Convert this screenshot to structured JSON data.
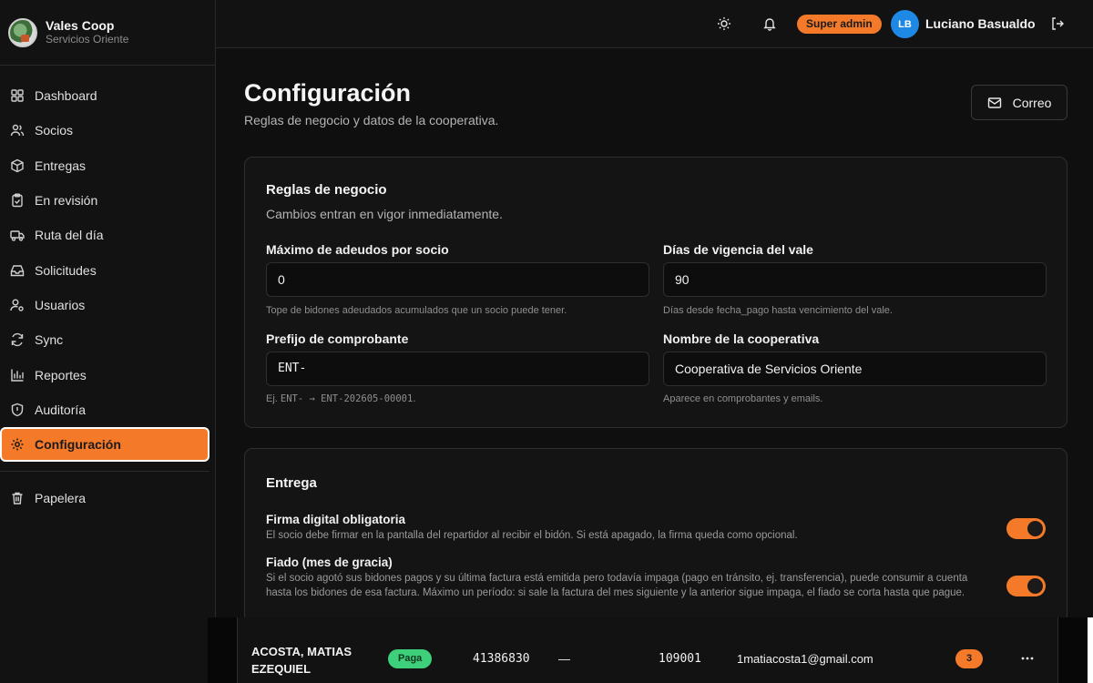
{
  "brand": {
    "name": "Vales Coop",
    "subtitle": "Servicios Oriente"
  },
  "sidebar": {
    "items": [
      {
        "label": "Dashboard",
        "icon": "grid-icon"
      },
      {
        "label": "Socios",
        "icon": "users-icon"
      },
      {
        "label": "Entregas",
        "icon": "package-icon"
      },
      {
        "label": "En revisión",
        "icon": "clipboard-icon"
      },
      {
        "label": "Ruta del día",
        "icon": "truck-icon"
      },
      {
        "label": "Solicitudes",
        "icon": "inbox-icon"
      },
      {
        "label": "Usuarios",
        "icon": "user-cog-icon"
      },
      {
        "label": "Sync",
        "icon": "refresh-icon"
      },
      {
        "label": "Reportes",
        "icon": "bar-chart-icon"
      },
      {
        "label": "Auditoría",
        "icon": "shield-icon"
      },
      {
        "label": "Configuración",
        "icon": "gear-icon",
        "active": true
      },
      {
        "label": "Papelera",
        "icon": "trash-icon"
      }
    ]
  },
  "topbar": {
    "role_badge": "Super admin",
    "avatar_initials": "LB",
    "user_name": "Luciano Basualdo"
  },
  "page": {
    "title": "Configuración",
    "subtitle": "Reglas de negocio y datos de la cooperativa.",
    "mail_button": "Correo"
  },
  "rules_card": {
    "title": "Reglas de negocio",
    "description": "Cambios entran en vigor inmediatamente.",
    "fields": {
      "max_debts": {
        "label": "Máximo de adeudos por socio",
        "value": "0",
        "help": "Tope de bidones adeudados acumulados que un socio puede tener."
      },
      "validity_days": {
        "label": "Días de vigencia del vale",
        "value": "90",
        "help": "Días desde fecha_pago hasta vencimiento del vale."
      },
      "receipt_prefix": {
        "label": "Prefijo de comprobante",
        "value": "ENT-",
        "help_prefix": "Ej.",
        "help_code": "ENT- → ENT-202605-00001",
        "help_suffix": "."
      },
      "coop_name": {
        "label": "Nombre de la cooperativa",
        "value": "Cooperativa de Servicios Oriente",
        "help": "Aparece en comprobantes y emails."
      }
    }
  },
  "delivery_card": {
    "title": "Entrega",
    "toggles": [
      {
        "title": "Firma digital obligatoria",
        "description": "El socio debe firmar en la pantalla del repartidor al recibir el bidón. Si está apagado, la firma queda como opcional.",
        "on": true
      },
      {
        "title": "Fiado (mes de gracia)",
        "description": "Si el socio agotó sus bidones pagos y su última factura está emitida pero todavía impaga (pago en tránsito, ej. transferencia), puede consumir a cuenta hasta los bidones de esa factura. Máximo un período: si sale la factura del mes siguiente y la anterior sigue impaga, el fiado se corta hasta que pague.",
        "on": true
      }
    ]
  },
  "member_row": {
    "name": "ACOSTA, MATIAS EZEQUIEL",
    "status": "Paga",
    "dni": "41386830",
    "dash": "—",
    "number": "109001",
    "email": "1matiacosta1@gmail.com",
    "count": "3"
  },
  "colors": {
    "accent": "#f47a2a",
    "paid": "#3ecf7a",
    "avatar": "#1e88e5"
  }
}
